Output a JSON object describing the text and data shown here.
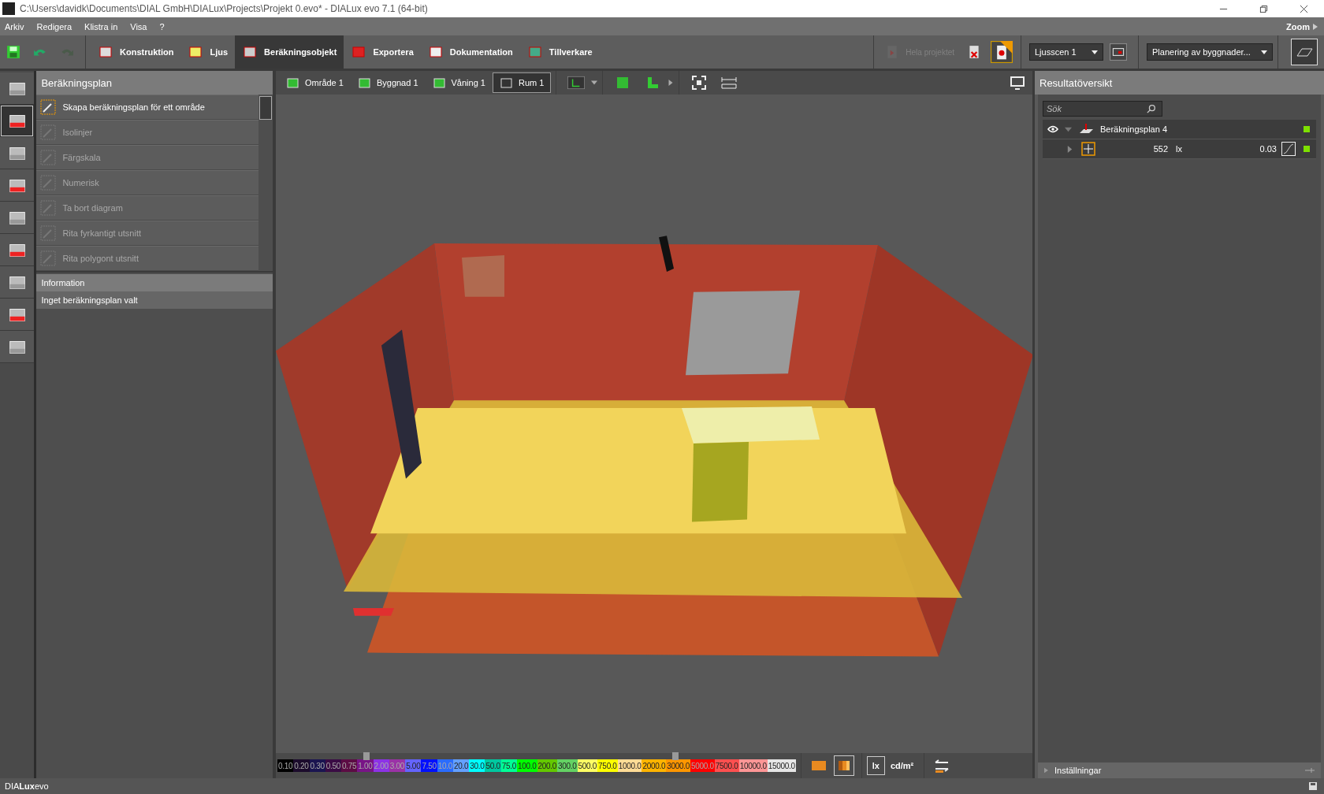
{
  "window": {
    "title": "C:\\Users\\davidk\\Documents\\DIAL GmbH\\DIALux\\Projects\\Projekt 0.evo* - DIALux evo 7.1  (64-bit)"
  },
  "menu": [
    "Arkiv",
    "Redigera",
    "Klistra in",
    "Visa",
    "?"
  ],
  "zoom_label": "Zoom",
  "modes": [
    {
      "label": "Konstruktion",
      "selected": false
    },
    {
      "label": "Ljus",
      "selected": false
    },
    {
      "label": "Beräkningsobjekt",
      "selected": true
    },
    {
      "label": "Exportera",
      "selected": false
    },
    {
      "label": "Dokumentation",
      "selected": false
    },
    {
      "label": "Tillverkare",
      "selected": false
    }
  ],
  "toolbar_right": {
    "project_button": "Hela projektet",
    "light_scene": "Ljusscen 1",
    "planning": "Planering av byggnader..."
  },
  "side_tools": [
    {
      "selected": false
    },
    {
      "selected": true
    },
    {
      "selected": false
    },
    {
      "selected": false
    },
    {
      "selected": false
    },
    {
      "selected": false
    },
    {
      "selected": false
    },
    {
      "selected": false
    },
    {
      "selected": false
    }
  ],
  "left_panel": {
    "title": "Beräkningsplan",
    "items": [
      {
        "label": "Skapa beräkningsplan för ett område",
        "disabled": false
      },
      {
        "label": "Isolinjer",
        "disabled": true
      },
      {
        "label": "Färgskala",
        "disabled": true
      },
      {
        "label": "Numerisk",
        "disabled": true
      },
      {
        "label": "Ta bort diagram",
        "disabled": true
      },
      {
        "label": "Rita fyrkantigt utsnitt",
        "disabled": true
      },
      {
        "label": "Rita polygont utsnitt",
        "disabled": true
      }
    ],
    "info_title": "Information",
    "info_text": "Inget beräkningsplan valt"
  },
  "breadcrumbs": [
    {
      "label": "Område 1",
      "selected": false
    },
    {
      "label": "Byggnad 1",
      "selected": false
    },
    {
      "label": "Våning 1",
      "selected": false
    },
    {
      "label": "Rum 1",
      "selected": true
    }
  ],
  "legend": [
    {
      "label": "0.10",
      "color": "#000000",
      "marked": false
    },
    {
      "label": "0.20",
      "color": "#1c0c2c",
      "marked": false
    },
    {
      "label": "0.30",
      "color": "#1a1450",
      "marked": false
    },
    {
      "label": "0.50",
      "color": "#3a0c44",
      "marked": false
    },
    {
      "label": "0.75",
      "color": "#5c0c44",
      "marked": false
    },
    {
      "label": "1.00",
      "color": "#781486",
      "marked": true
    },
    {
      "label": "2.00",
      "color": "#8c32e6",
      "marked": false
    },
    {
      "label": "3.00",
      "color": "#9a32a6",
      "marked": false
    },
    {
      "label": "5.00",
      "color": "#6464ff",
      "marked": false
    },
    {
      "label": "7.50",
      "color": "#0010ff",
      "marked": false
    },
    {
      "label": "10.0",
      "color": "#2a6cff",
      "marked": false
    },
    {
      "label": "20.0",
      "color": "#64a0ff",
      "marked": false
    },
    {
      "label": "30.0",
      "color": "#00ffff",
      "marked": false
    },
    {
      "label": "50.0",
      "color": "#00c8a0",
      "marked": false
    },
    {
      "label": "75.0",
      "color": "#00ff96",
      "marked": false
    },
    {
      "label": "100.0",
      "color": "#00ff00",
      "marked": false
    },
    {
      "label": "200.0",
      "color": "#64c800",
      "marked": false
    },
    {
      "label": "300.0",
      "color": "#64d264",
      "marked": false
    },
    {
      "label": "500.0",
      "color": "#ffff64",
      "marked": false
    },
    {
      "label": "750.0",
      "color": "#ffff00",
      "marked": false
    },
    {
      "label": "1000.0",
      "color": "#ffdc96",
      "marked": false
    },
    {
      "label": "2000.0",
      "color": "#ffb400",
      "marked": false
    },
    {
      "label": "3000.0",
      "color": "#ff9600",
      "marked": true
    },
    {
      "label": "5000.0",
      "color": "#ff0000",
      "marked": false
    },
    {
      "label": "7500.0",
      "color": "#ff5050",
      "marked": false
    },
    {
      "label": "10000.0",
      "color": "#ff9696",
      "marked": false
    },
    {
      "label": "15000.0",
      "color": "#e6e6e6",
      "marked": false
    }
  ],
  "units": [
    {
      "label": "lx",
      "selected": true
    },
    {
      "label": "cd/m²",
      "selected": false
    }
  ],
  "right_panel": {
    "title": "Resultatöversikt",
    "search": {
      "placeholder": "Sök"
    },
    "tree": [
      {
        "label": "Beräkningsplan 4",
        "expanded": true,
        "children": [
          {
            "value": "552",
            "unit": "lx",
            "ratio": "0.03",
            "expanded": false
          }
        ]
      }
    ],
    "footer": "Inställningar"
  },
  "status_bar": "DIA**Lux**evo"
}
